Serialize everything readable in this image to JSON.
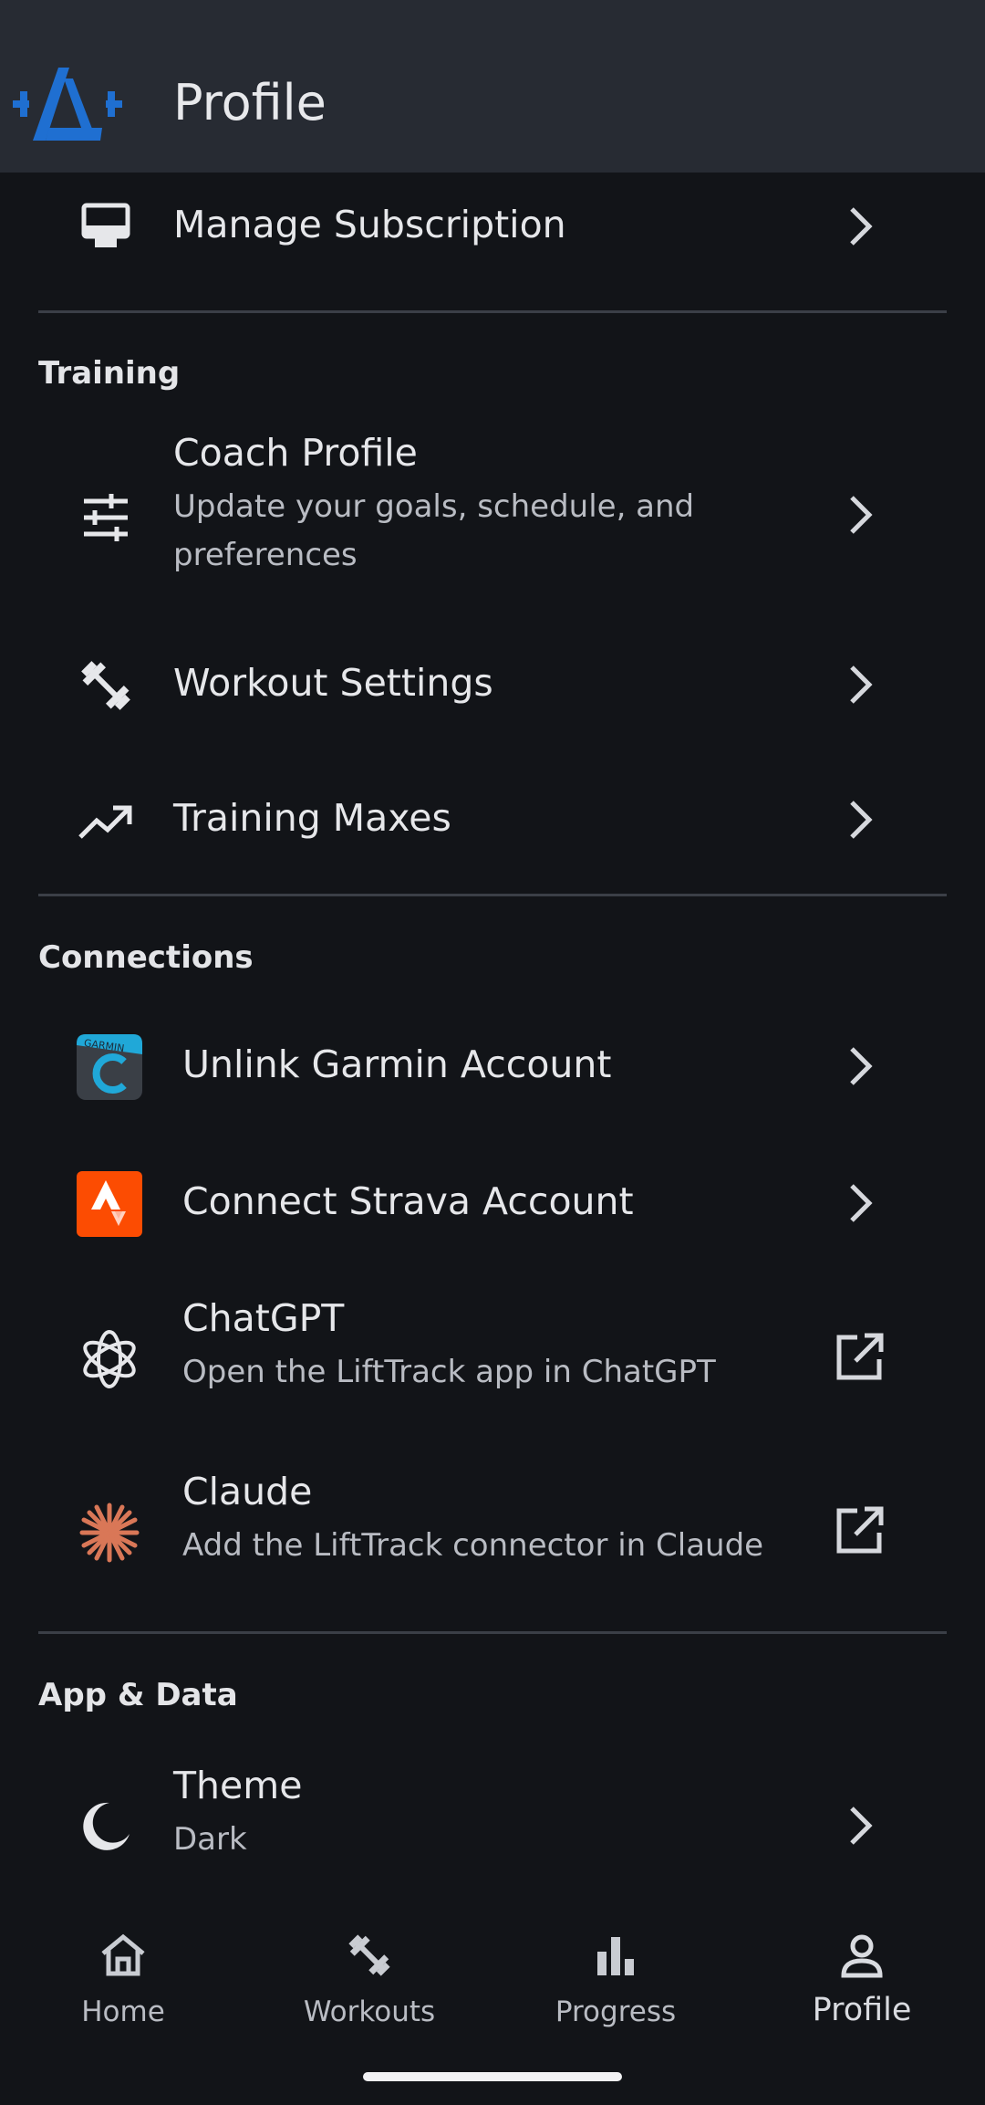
{
  "appbar": {
    "title": "Profile",
    "logo_icon": "lifttrack-logo-icon",
    "accent_color": "#1f6fd1"
  },
  "account": {
    "manage_subscription": {
      "title": "Manage Subscription",
      "icon": "card-icon"
    }
  },
  "training": {
    "header": "Training",
    "coach_profile": {
      "title": "Coach Profile",
      "subtitle": "Update your goals, schedule, and preferences",
      "icon": "tune-sliders-icon"
    },
    "workout_settings": {
      "title": "Workout Settings",
      "icon": "dumbbell-icon"
    },
    "training_maxes": {
      "title": "Training Maxes",
      "icon": "trending-up-icon"
    }
  },
  "connections": {
    "header": "Connections",
    "garmin": {
      "title": "Unlink Garmin Account",
      "icon": "garmin-connect-icon",
      "logo_text": "GARMIN",
      "color": "#20a8d8"
    },
    "strava": {
      "title": "Connect Strava Account",
      "icon": "strava-icon",
      "color": "#fc4c02"
    },
    "chatgpt": {
      "title": "ChatGPT",
      "subtitle": "Open the LiftTrack app in ChatGPT",
      "icon": "openai-knot-icon"
    },
    "claude": {
      "title": "Claude",
      "subtitle": "Add the LiftTrack connector in Claude",
      "icon": "claude-starburst-icon",
      "color": "#d97757"
    }
  },
  "app_data": {
    "header": "App & Data",
    "theme": {
      "title": "Theme",
      "subtitle": "Dark",
      "icon": "moon-icon"
    }
  },
  "bottom_nav": {
    "items": [
      {
        "label": "Home",
        "icon": "home-icon"
      },
      {
        "label": "Workouts",
        "icon": "dumbbell-icon"
      },
      {
        "label": "Progress",
        "icon": "bar-chart-icon"
      },
      {
        "label": "Profile",
        "icon": "person-icon"
      }
    ],
    "active": "Profile"
  }
}
